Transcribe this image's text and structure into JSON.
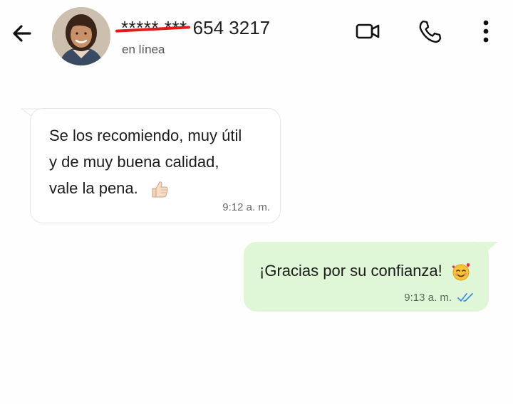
{
  "header": {
    "masked_number": "*****  ***",
    "visible_digits": "654  3217",
    "status": "en línea"
  },
  "messages": [
    {
      "direction": "incoming",
      "lines": [
        "Se los recomiendo, muy útil",
        "y de muy buena calidad,",
        "vale la pena."
      ],
      "emoji": "thumbs-up",
      "time": "9:12 a. m."
    },
    {
      "direction": "outgoing",
      "text": "¡Gracias por su confianza!",
      "emoji": "smiling-face-with-hearts",
      "time": "9:13 a. m.",
      "read_receipt": "double-check-blue"
    }
  ],
  "colors": {
    "outgoing_bubble": "#dff7d6",
    "incoming_bubble": "#ffffff",
    "read_tick": "#3b8fe0",
    "redaction_line": "#e11b1b"
  }
}
